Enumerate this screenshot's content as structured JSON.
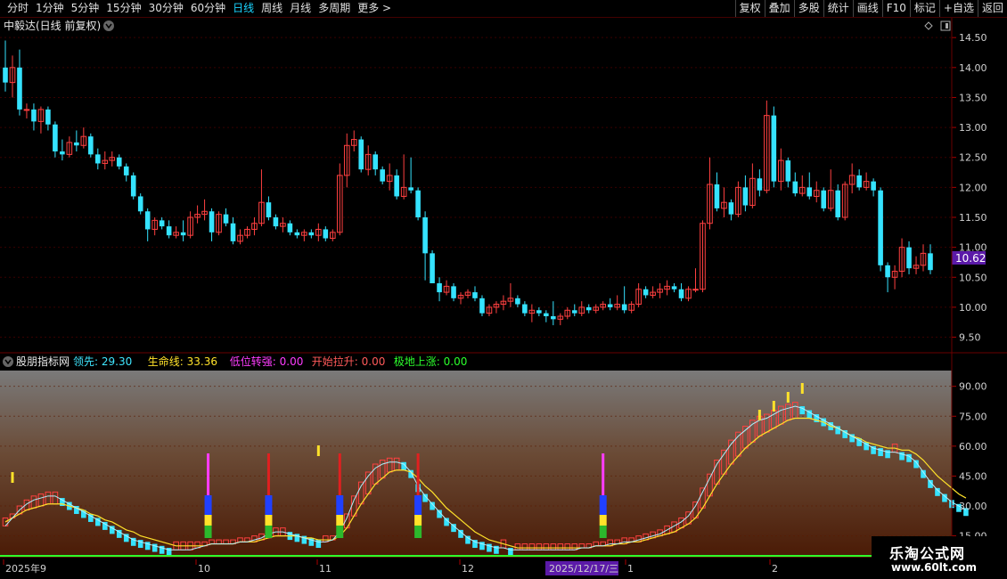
{
  "toolbar": {
    "periods": [
      "分时",
      "1分钟",
      "5分钟",
      "15分钟",
      "30分钟",
      "60分钟",
      "日线",
      "周线",
      "月线",
      "多周期",
      "更多 >"
    ],
    "active_period": "日线",
    "actions": [
      "复权",
      "叠加",
      "多股",
      "统计",
      "画线",
      "F10",
      "标记",
      "+自选",
      "返回"
    ]
  },
  "price_panel": {
    "title": "中毅达(日线 前复权)",
    "current_price_tag": "10.62",
    "y_ticks": [
      "14.50",
      "14.00",
      "13.50",
      "13.00",
      "12.50",
      "12.00",
      "11.50",
      "11.00",
      "10.50",
      "10.00",
      "9.50"
    ]
  },
  "indicator_panel": {
    "name": "股朋指标网",
    "legend": [
      {
        "label": "领先: 29.30",
        "color": "#3fe6ff"
      },
      {
        "label": "生命线: 33.36",
        "color": "#ffe22a"
      },
      {
        "label": "低位转强: 0.00",
        "color": "#ff3cff"
      },
      {
        "label": "开始拉升: 0.00",
        "color": "#ff5a5a"
      },
      {
        "label": "极地上涨: 0.00",
        "color": "#2cff2c"
      }
    ],
    "y_ticks": [
      "90.00",
      "75.00",
      "60.00",
      "45.00",
      "30.00",
      "15.00"
    ]
  },
  "date_axis": {
    "labels": [
      "2025年9",
      "10",
      "11",
      "12",
      "1",
      "2"
    ],
    "cursor_label": "2025/12/17/三"
  },
  "watermark": {
    "line1": "乐淘公式网",
    "line2": "www.60lt.com"
  },
  "colors": {
    "up": "#ff4040",
    "down": "#35e3ff",
    "bg": "#000000",
    "grid": "#5a0000",
    "price_tag": "#5b1aa8"
  },
  "chart_data": {
    "type": "candlestick",
    "price_series": {
      "name": "中毅达",
      "ohlc": [
        [
          14.0,
          14.45,
          13.6,
          13.75
        ],
        [
          13.75,
          14.2,
          13.5,
          14.0
        ],
        [
          14.0,
          14.3,
          13.2,
          13.3
        ],
        [
          13.3,
          13.4,
          13.15,
          13.3
        ],
        [
          13.3,
          13.4,
          12.95,
          13.1
        ],
        [
          13.1,
          13.35,
          12.9,
          13.3
        ],
        [
          13.3,
          13.35,
          12.95,
          13.05
        ],
        [
          13.05,
          13.1,
          12.5,
          12.6
        ],
        [
          12.6,
          12.8,
          12.45,
          12.55
        ],
        [
          12.55,
          12.85,
          12.5,
          12.75
        ],
        [
          12.75,
          12.95,
          12.6,
          12.7
        ],
        [
          12.7,
          13.0,
          12.65,
          12.85
        ],
        [
          12.85,
          12.9,
          12.5,
          12.55
        ],
        [
          12.55,
          12.65,
          12.3,
          12.4
        ],
        [
          12.4,
          12.6,
          12.3,
          12.45
        ],
        [
          12.45,
          12.6,
          12.35,
          12.5
        ],
        [
          12.5,
          12.55,
          12.3,
          12.35
        ],
        [
          12.35,
          12.4,
          12.1,
          12.2
        ],
        [
          12.2,
          12.25,
          11.8,
          11.85
        ],
        [
          11.85,
          11.9,
          11.55,
          11.6
        ],
        [
          11.6,
          11.65,
          11.1,
          11.3
        ],
        [
          11.3,
          11.5,
          11.2,
          11.45
        ],
        [
          11.45,
          11.5,
          11.3,
          11.35
        ],
        [
          11.35,
          11.45,
          11.15,
          11.2
        ],
        [
          11.2,
          11.35,
          11.15,
          11.25
        ],
        [
          11.25,
          11.45,
          11.1,
          11.2
        ],
        [
          11.2,
          11.6,
          11.15,
          11.5
        ],
        [
          11.5,
          11.7,
          11.4,
          11.55
        ],
        [
          11.55,
          11.8,
          11.45,
          11.6
        ],
        [
          11.6,
          11.65,
          11.1,
          11.25
        ],
        [
          11.25,
          11.6,
          11.2,
          11.55
        ],
        [
          11.55,
          11.65,
          11.35,
          11.4
        ],
        [
          11.4,
          11.5,
          11.05,
          11.1
        ],
        [
          11.1,
          11.3,
          11.05,
          11.2
        ],
        [
          11.2,
          11.35,
          11.15,
          11.3
        ],
        [
          11.3,
          11.5,
          11.2,
          11.4
        ],
        [
          11.4,
          12.3,
          11.35,
          11.75
        ],
        [
          11.75,
          11.85,
          11.45,
          11.5
        ],
        [
          11.5,
          11.55,
          11.3,
          11.35
        ],
        [
          11.35,
          11.5,
          11.25,
          11.4
        ],
        [
          11.4,
          11.45,
          11.2,
          11.25
        ],
        [
          11.25,
          11.3,
          11.15,
          11.2
        ],
        [
          11.2,
          11.3,
          11.1,
          11.25
        ],
        [
          11.25,
          11.3,
          11.15,
          11.2
        ],
        [
          11.2,
          11.4,
          11.1,
          11.3
        ],
        [
          11.3,
          11.35,
          11.1,
          11.15
        ],
        [
          11.15,
          11.3,
          11.1,
          11.25
        ],
        [
          11.25,
          12.4,
          11.2,
          12.2
        ],
        [
          12.2,
          12.9,
          12.0,
          12.7
        ],
        [
          12.7,
          12.95,
          12.6,
          12.8
        ],
        [
          12.8,
          12.85,
          12.25,
          12.3
        ],
        [
          12.3,
          12.7,
          12.2,
          12.55
        ],
        [
          12.55,
          12.6,
          12.2,
          12.3
        ],
        [
          12.3,
          12.35,
          12.05,
          12.1
        ],
        [
          12.1,
          12.4,
          11.95,
          12.2
        ],
        [
          12.2,
          12.3,
          11.8,
          11.85
        ],
        [
          11.85,
          12.55,
          11.8,
          12.0
        ],
        [
          12.0,
          12.5,
          11.9,
          11.95
        ],
        [
          11.95,
          12.0,
          11.45,
          11.5
        ],
        [
          11.5,
          11.6,
          10.45,
          10.9
        ],
        [
          10.9,
          10.95,
          10.6,
          10.4
        ],
        [
          10.4,
          10.5,
          10.1,
          10.25
        ],
        [
          10.25,
          10.45,
          10.2,
          10.35
        ],
        [
          10.35,
          10.4,
          10.1,
          10.15
        ],
        [
          10.15,
          10.25,
          10.05,
          10.2
        ],
        [
          10.2,
          10.3,
          10.15,
          10.25
        ],
        [
          10.25,
          10.35,
          10.1,
          10.15
        ],
        [
          10.15,
          10.2,
          9.85,
          9.9
        ],
        [
          9.9,
          10.05,
          9.85,
          10.0
        ],
        [
          10.0,
          10.1,
          9.9,
          10.05
        ],
        [
          10.05,
          10.2,
          9.95,
          10.1
        ],
        [
          10.1,
          10.4,
          10.0,
          10.15
        ],
        [
          10.15,
          10.2,
          10.0,
          10.05
        ],
        [
          10.05,
          10.1,
          9.85,
          9.9
        ],
        [
          9.9,
          10.05,
          9.75,
          9.95
        ],
        [
          9.95,
          10.0,
          9.85,
          9.9
        ],
        [
          9.9,
          9.95,
          9.75,
          9.85
        ],
        [
          9.85,
          10.1,
          9.7,
          9.8
        ],
        [
          9.8,
          9.9,
          9.7,
          9.85
        ],
        [
          9.85,
          10.0,
          9.8,
          9.95
        ],
        [
          9.95,
          10.05,
          9.85,
          9.9
        ],
        [
          9.9,
          10.1,
          9.85,
          10.0
        ],
        [
          10.0,
          10.05,
          9.9,
          9.95
        ],
        [
          9.95,
          10.05,
          9.9,
          10.0
        ],
        [
          10.0,
          10.1,
          9.95,
          10.05
        ],
        [
          10.05,
          10.15,
          9.95,
          10.0
        ],
        [
          10.0,
          10.2,
          9.95,
          10.05
        ],
        [
          10.05,
          10.35,
          9.9,
          9.95
        ],
        [
          9.95,
          10.1,
          9.9,
          10.05
        ],
        [
          10.05,
          10.4,
          10.0,
          10.3
        ],
        [
          10.3,
          10.35,
          10.15,
          10.2
        ],
        [
          10.2,
          10.35,
          10.15,
          10.25
        ],
        [
          10.25,
          10.4,
          10.15,
          10.3
        ],
        [
          10.3,
          10.45,
          10.2,
          10.35
        ],
        [
          10.35,
          10.4,
          10.25,
          10.3
        ],
        [
          10.3,
          10.4,
          10.1,
          10.15
        ],
        [
          10.15,
          10.35,
          10.1,
          10.3
        ],
        [
          10.3,
          10.65,
          10.25,
          10.3
        ],
        [
          10.3,
          11.45,
          10.25,
          11.4
        ],
        [
          11.4,
          12.5,
          11.3,
          12.05
        ],
        [
          12.05,
          12.25,
          11.6,
          11.65
        ],
        [
          11.65,
          12.0,
          11.5,
          11.75
        ],
        [
          11.75,
          11.8,
          11.45,
          11.55
        ],
        [
          11.55,
          12.1,
          11.5,
          12.0
        ],
        [
          12.0,
          12.2,
          11.6,
          11.7
        ],
        [
          11.7,
          12.4,
          11.65,
          12.15
        ],
        [
          12.15,
          12.3,
          11.85,
          11.95
        ],
        [
          11.95,
          13.45,
          11.9,
          13.2
        ],
        [
          13.2,
          13.35,
          12.0,
          12.1
        ],
        [
          12.1,
          12.65,
          11.95,
          12.45
        ],
        [
          12.45,
          12.5,
          12.0,
          12.1
        ],
        [
          12.1,
          12.25,
          11.85,
          11.9
        ],
        [
          11.9,
          12.2,
          11.85,
          12.0
        ],
        [
          12.0,
          12.25,
          11.8,
          11.85
        ],
        [
          11.85,
          12.1,
          11.75,
          11.95
        ],
        [
          11.95,
          12.0,
          11.6,
          11.65
        ],
        [
          11.65,
          12.3,
          11.6,
          11.95
        ],
        [
          11.95,
          12.05,
          11.45,
          11.5
        ],
        [
          11.5,
          12.1,
          11.45,
          12.05
        ],
        [
          12.05,
          12.4,
          11.9,
          12.2
        ],
        [
          12.2,
          12.3,
          11.95,
          12.0
        ],
        [
          12.0,
          12.25,
          11.95,
          12.1
        ],
        [
          12.1,
          12.15,
          11.85,
          11.95
        ],
        [
          11.95,
          12.0,
          10.6,
          10.7
        ],
        [
          10.7,
          10.75,
          10.25,
          10.5
        ],
        [
          10.5,
          10.7,
          10.3,
          10.6
        ],
        [
          10.6,
          11.15,
          10.5,
          11.0
        ],
        [
          11.0,
          11.1,
          10.55,
          10.65
        ],
        [
          10.65,
          10.85,
          10.55,
          10.7
        ],
        [
          10.7,
          11.05,
          10.6,
          10.9
        ],
        [
          10.9,
          11.05,
          10.55,
          10.62
        ]
      ]
    },
    "price_y_range": [
      9.3,
      14.8
    ],
    "indicator": {
      "y_range": [
        5,
        97
      ],
      "领先": [
        20,
        24,
        28,
        31,
        33,
        34,
        35,
        35,
        33,
        31,
        29,
        27,
        25,
        23,
        21,
        19,
        17,
        15,
        13,
        12,
        11,
        10,
        9,
        8,
        8,
        8,
        8,
        9,
        10,
        11,
        11,
        11,
        11,
        12,
        12,
        13,
        14,
        16,
        17,
        17,
        16,
        15,
        14,
        13,
        12,
        12,
        13,
        17,
        24,
        33,
        40,
        45,
        49,
        51,
        52,
        52,
        51,
        47,
        40,
        35,
        31,
        27,
        23,
        20,
        17,
        14,
        12,
        11,
        10,
        9,
        9,
        8,
        8,
        8,
        8,
        8,
        8,
        8,
        8,
        8,
        8,
        9,
        9,
        10,
        10,
        11,
        11,
        12,
        12,
        13,
        14,
        15,
        16,
        18,
        20,
        22,
        25,
        30,
        37,
        44,
        51,
        56,
        61,
        65,
        68,
        71,
        73,
        74,
        76,
        78,
        79,
        80,
        79,
        77,
        75,
        73,
        71,
        69,
        67,
        65,
        63,
        61,
        59,
        58,
        57,
        57,
        56,
        55,
        52,
        47,
        42,
        38,
        35,
        32,
        30,
        28
      ],
      "生命线": [
        22,
        24,
        26,
        28,
        29,
        30,
        31,
        31,
        31,
        30,
        29,
        28,
        26,
        25,
        23,
        22,
        20,
        18,
        17,
        15,
        14,
        13,
        12,
        11,
        10,
        10,
        10,
        10,
        10,
        11,
        11,
        11,
        11,
        12,
        12,
        12,
        13,
        14,
        15,
        15,
        15,
        15,
        14,
        14,
        13,
        13,
        13,
        15,
        19,
        25,
        31,
        36,
        41,
        44,
        47,
        48,
        48,
        47,
        44,
        40,
        37,
        33,
        29,
        26,
        23,
        20,
        17,
        15,
        13,
        12,
        11,
        10,
        9,
        9,
        9,
        9,
        9,
        9,
        9,
        9,
        9,
        9,
        9,
        10,
        10,
        10,
        11,
        11,
        12,
        12,
        13,
        14,
        15,
        16,
        17,
        19,
        21,
        24,
        29,
        35,
        41,
        46,
        51,
        55,
        59,
        62,
        65,
        67,
        69,
        71,
        73,
        74,
        74,
        74,
        73,
        72,
        70,
        69,
        67,
        65,
        64,
        62,
        61,
        60,
        59,
        59,
        58,
        58,
        56,
        53,
        49,
        45,
        42,
        39,
        36,
        34
      ]
    }
  }
}
